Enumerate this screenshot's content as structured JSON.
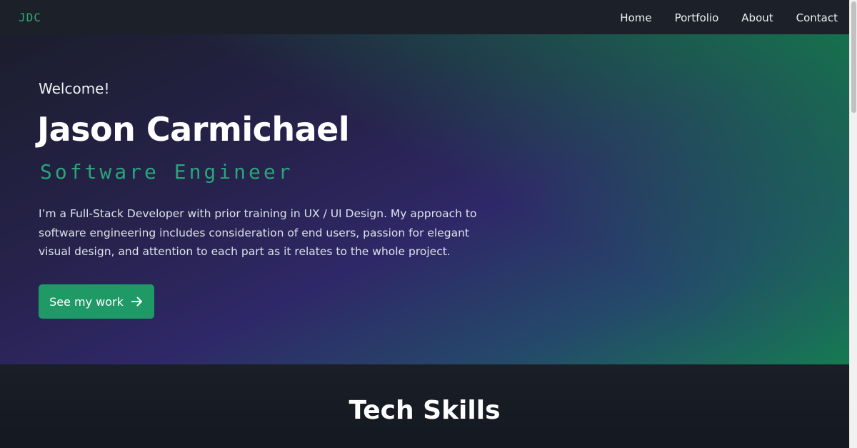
{
  "nav": {
    "logo": "JDC",
    "links": [
      "Home",
      "Portfolio",
      "About",
      "Contact"
    ]
  },
  "hero": {
    "greeting": "Welcome!",
    "name": "Jason Carmichael",
    "role": "Software Engineer",
    "bio": "I’m a Full-Stack Developer with prior training in UX / UI Design. My approach to software engineering includes consideration of end users, passion for elegant visual design, and attention to each part as it relates to the whole project.",
    "cta_label": "See my work",
    "cta_icon": "arrow-right-icon"
  },
  "skills": {
    "title": "Tech Skills"
  },
  "colors": {
    "accent": "#1f9a66",
    "role_text": "#2aa47a",
    "nav_bg": "#1c2029"
  }
}
